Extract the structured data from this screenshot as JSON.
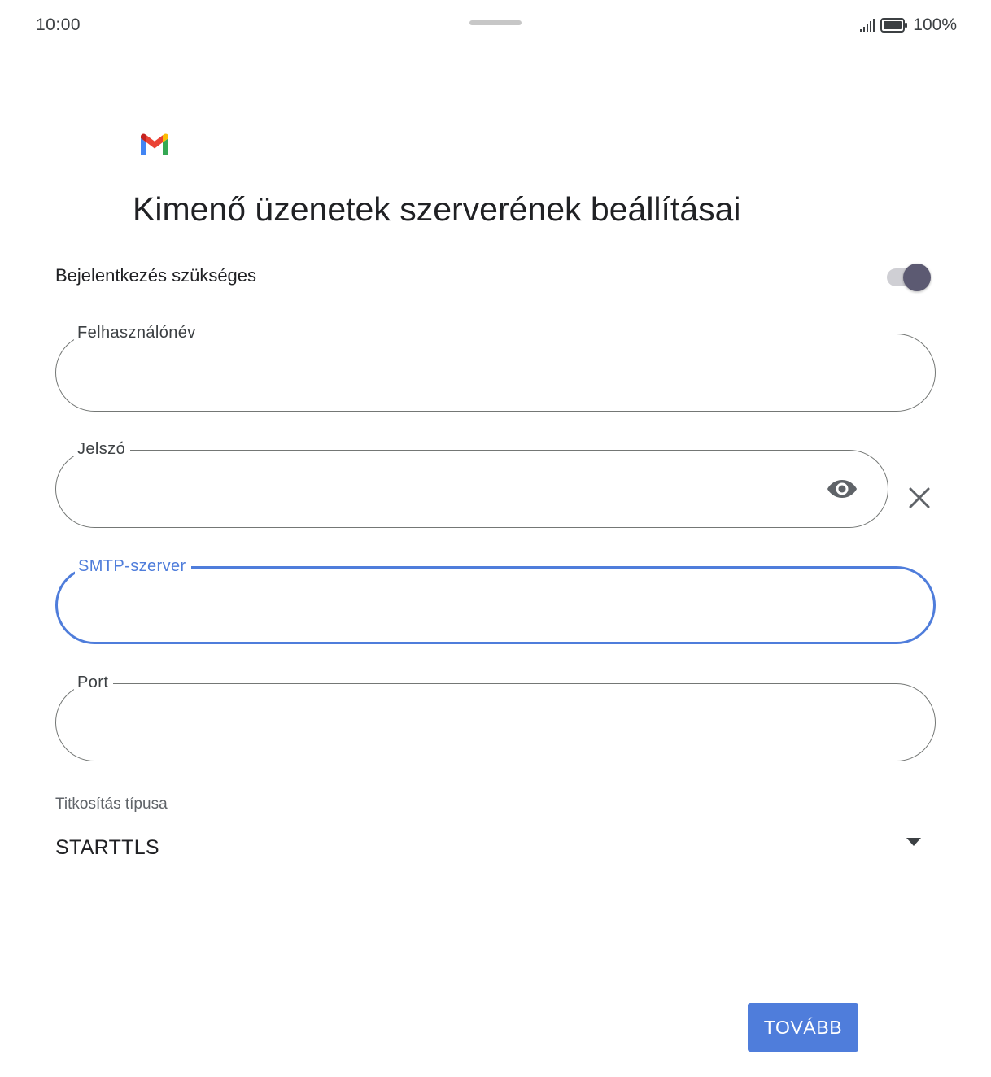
{
  "status_bar": {
    "time": "10:00",
    "battery_percent": "100%",
    "signal_icon": "signal-bars-icon",
    "battery_icon": "battery-full-icon"
  },
  "app": {
    "logo_icon": "gmail-logo",
    "title": "Kimenő üzenetek szerverének beállításai"
  },
  "login_required": {
    "label": "Bejelentkezés szükséges",
    "enabled": true
  },
  "fields": {
    "username": {
      "label": "Felhasználónév",
      "value": ""
    },
    "password": {
      "label": "Jelszó",
      "value": "",
      "toggle_visibility_icon": "eye-icon",
      "clear_icon": "close-icon"
    },
    "smtp_server": {
      "label": "SMTP-szerver",
      "value": "",
      "focused": true
    },
    "port": {
      "label": "Port",
      "value": ""
    }
  },
  "encryption": {
    "label": "Titkosítás típusa",
    "selected": "STARTTLS",
    "dropdown_icon": "dropdown-arrow-icon"
  },
  "actions": {
    "next_label": "TOVÁBB"
  },
  "colors": {
    "accent": "#4f7ddb",
    "toggle_thumb": "#5c5a72",
    "outline": "#747775"
  }
}
